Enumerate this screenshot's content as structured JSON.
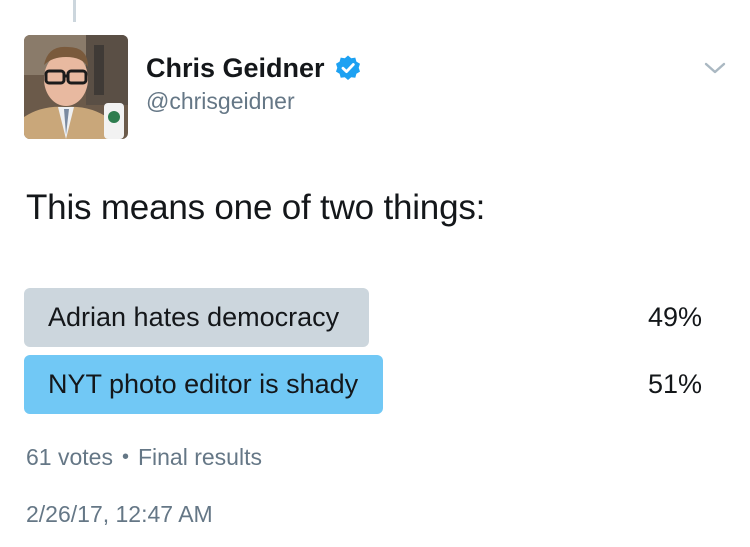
{
  "tweet": {
    "author": {
      "display_name": "Chris Geidner",
      "handle": "@chrisgeidner",
      "verified": true,
      "avatar_icon": "profile-photo"
    },
    "text": "This means one of two things:",
    "poll": {
      "options": [
        {
          "label": "Adrian hates democracy",
          "percent_label": "49%",
          "percent": 49,
          "winner": false
        },
        {
          "label": "NYT photo editor is shady",
          "percent_label": "51%",
          "percent": 51,
          "winner": true
        }
      ],
      "votes": "61 votes",
      "separator": "•",
      "status": "Final results"
    },
    "timestamp": "2/26/17, 12:47 AM"
  },
  "colors": {
    "verified_blue": "#1da1f2",
    "bar_loser": "#ccd6dd",
    "bar_winner": "#71c8f5",
    "secondary_text": "#657786"
  }
}
